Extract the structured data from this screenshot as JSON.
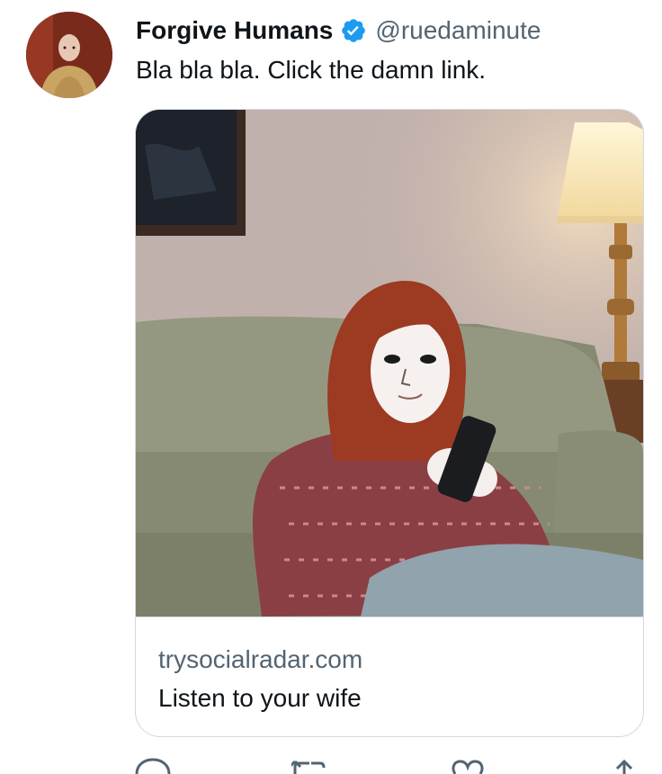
{
  "tweet": {
    "author_name": "Forgive Humans",
    "author_handle": "@ruedaminute",
    "verified": true,
    "text": "Bla bla bla. Click the damn link."
  },
  "card": {
    "domain": "trysocialradar.com",
    "title": "Listen to your wife"
  },
  "actions": {
    "icons": [
      "reply-icon",
      "retweet-icon",
      "like-icon",
      "share-icon"
    ]
  },
  "colors": {
    "verified": "#1d9bf0",
    "secondary_text": "#536471",
    "border": "#cfd9de"
  }
}
